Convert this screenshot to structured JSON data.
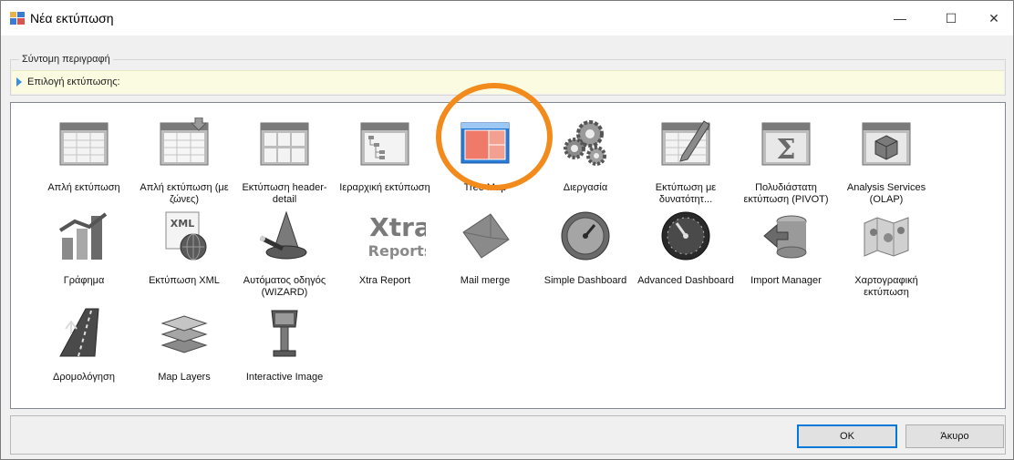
{
  "window": {
    "title": "Νέα εκτύπωση",
    "controls": {
      "minimize": "—",
      "maximize": "☐",
      "close": "✕"
    }
  },
  "group": {
    "legend": "Σύντομη περιγραφή",
    "selection_label": "Επιλογή εκτύπωσης:"
  },
  "items": [
    {
      "label": "Απλή εκτύπωση",
      "icon": "simple-print-icon"
    },
    {
      "label": "Απλή εκτύπωση (με ζώνες)",
      "icon": "banded-print-icon"
    },
    {
      "label": "Εκτύπωση header-detail",
      "icon": "header-detail-icon"
    },
    {
      "label": "Ιεραρχική εκτύπωση",
      "icon": "hierarchy-icon"
    },
    {
      "label": "Tree Map",
      "icon": "tree-map-icon"
    },
    {
      "label": "Διεργασία",
      "icon": "gears-icon"
    },
    {
      "label": "Εκτύπωση με δυνατότητ...",
      "icon": "editable-print-icon"
    },
    {
      "label": "Πολυδιάστατη εκτύπωση (PIVOT)",
      "icon": "pivot-icon"
    },
    {
      "label": "Analysis Services (OLAP)",
      "icon": "olap-cube-icon"
    },
    {
      "label": "Γράφημα",
      "icon": "chart-icon"
    },
    {
      "label": "Εκτύπωση XML",
      "icon": "xml-globe-icon"
    },
    {
      "label": "Αυτόματος οδηγός (WIZARD)",
      "icon": "wizard-hat-icon"
    },
    {
      "label": "Xtra Report",
      "icon": "xtra-reports-logo"
    },
    {
      "label": "Mail merge",
      "icon": "envelope-icon"
    },
    {
      "label": "Simple Dashboard",
      "icon": "gauge-icon"
    },
    {
      "label": "Advanced Dashboard",
      "icon": "speedometer-icon"
    },
    {
      "label": "Import Manager",
      "icon": "database-import-icon"
    },
    {
      "label": "Χαρτογραφική εκτύπωση",
      "icon": "map-icon"
    },
    {
      "label": "Δρομολόγηση",
      "icon": "road-icon"
    },
    {
      "label": "Map Layers",
      "icon": "map-layers-icon"
    },
    {
      "label": "Interactive Image",
      "icon": "kiosk-icon"
    }
  ],
  "xtra_logo": {
    "line1": "Xtra",
    "line2": "Reports"
  },
  "buttons": {
    "ok": "OK",
    "cancel": "Άκυρο"
  },
  "colors": {
    "accent": "#f28a1c",
    "selection_bg": "#fbfbe1",
    "focus": "#0078d7"
  }
}
